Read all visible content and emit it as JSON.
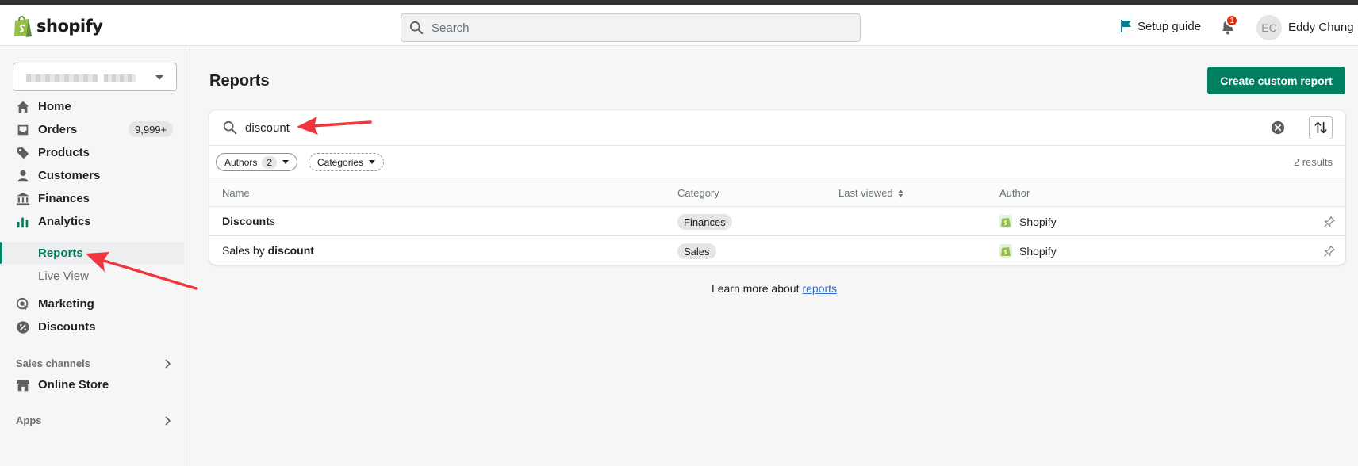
{
  "app": {
    "brand": "shopify",
    "search_placeholder": "Search",
    "setup_guide": "Setup guide",
    "notifications_count": "1",
    "avatar_initials": "EC",
    "user_name": "Eddy Chung"
  },
  "sidebar": {
    "items": [
      {
        "label": "Home",
        "icon": "home-icon"
      },
      {
        "label": "Orders",
        "icon": "orders-icon",
        "badge": "9,999+"
      },
      {
        "label": "Products",
        "icon": "tag-icon"
      },
      {
        "label": "Customers",
        "icon": "person-icon"
      },
      {
        "label": "Finances",
        "icon": "bank-icon"
      },
      {
        "label": "Analytics",
        "icon": "bar-chart-icon"
      }
    ],
    "analytics_sub": [
      {
        "label": "Reports"
      },
      {
        "label": "Live View"
      }
    ],
    "items2": [
      {
        "label": "Marketing",
        "icon": "target-icon"
      },
      {
        "label": "Discounts",
        "icon": "discount-icon"
      }
    ],
    "sales_channels": "Sales channels",
    "online_store": "Online Store",
    "apps": "Apps"
  },
  "main": {
    "title": "Reports",
    "create_button": "Create custom report",
    "filter_query": "discount",
    "chips": {
      "authors": "Authors",
      "authors_count": "2",
      "categories": "Categories"
    },
    "results": "2 results",
    "columns": [
      "Name",
      "Category",
      "Last viewed",
      "Author"
    ],
    "rows": [
      {
        "name_bold": "Discount",
        "name_rest": "s",
        "category": "Finances",
        "author": "Shopify"
      },
      {
        "name_pre": "Sales by ",
        "name_bold": "discount",
        "category": "Sales",
        "author": "Shopify"
      }
    ],
    "learn_more": "Learn more about",
    "learn_link": "reports"
  },
  "colors": {
    "accent": "#008060",
    "annotation_arrow": "#f0353d"
  }
}
